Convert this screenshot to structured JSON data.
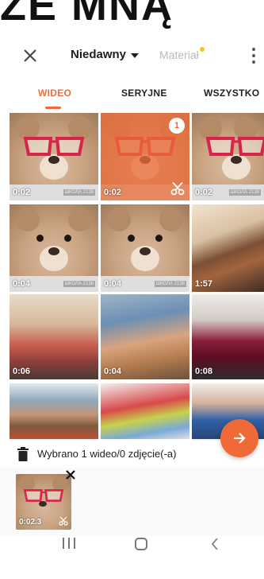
{
  "banner": {
    "cut_text": "ZE MNĄ"
  },
  "toolbar": {
    "source_label": "Niedawny",
    "material_label": "Materiał"
  },
  "tabs": [
    {
      "label": "WIDEO",
      "active": true
    },
    {
      "label": "SERYJNE",
      "active": false
    },
    {
      "label": "WSZYSTKO",
      "active": false
    }
  ],
  "grid": {
    "items": [
      {
        "type": "teddy",
        "duration": "0:02",
        "watermark": "ШКОЛА 2138"
      },
      {
        "type": "teddy",
        "duration": "0:02",
        "selected": true,
        "selection_index": "1"
      },
      {
        "type": "teddy",
        "duration": "0:02",
        "watermark": "ШКОЛА 2138"
      },
      {
        "type": "teddy",
        "duration": "0:04",
        "watermark": "ШКОЛА 2138"
      },
      {
        "type": "teddy",
        "duration": "0:04",
        "watermark": "ШКОЛА 2138"
      },
      {
        "type": "kitchen",
        "duration": "1:57"
      },
      {
        "type": "kids",
        "duration": "0:06"
      },
      {
        "type": "boy",
        "duration": "0:04"
      },
      {
        "type": "blender",
        "duration": "0:08"
      },
      {
        "type": "craft",
        "duration": ""
      },
      {
        "type": "red",
        "duration": ""
      },
      {
        "type": "blue",
        "duration": ""
      }
    ]
  },
  "selection": {
    "summary": "Wybrano 1 wideo/0 zdjęcie(-a)"
  },
  "tray": {
    "duration": "0:02.3"
  },
  "colors": {
    "accent": "#ea6d3a",
    "next_button": "#ef6a36",
    "material_dot": "#f5c518"
  },
  "icons": {
    "close": "close-icon",
    "caret": "caret-down-icon",
    "more": "more-vertical-icon",
    "trash": "trash-icon",
    "next": "arrow-right-icon",
    "scissor": "scissor-icon"
  }
}
